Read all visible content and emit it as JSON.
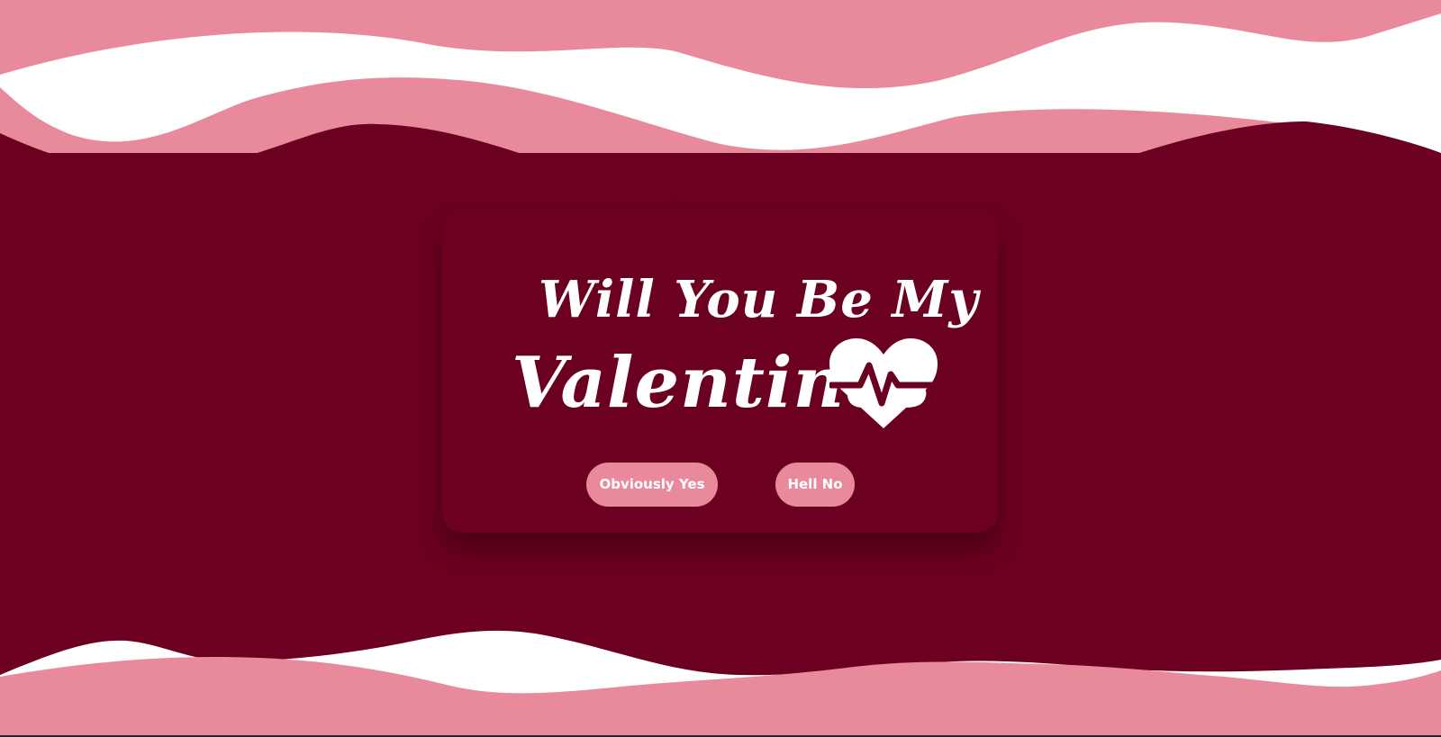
{
  "colors": {
    "background": "#6b0020",
    "wave_pink": "#e88a9c",
    "wave_white": "#ffffff",
    "text": "#ffffff",
    "button_bg": "#e88a9c"
  },
  "hero": {
    "line1": "Will You Be My",
    "line2": "Valentines",
    "icon": "heart-pulse-icon"
  },
  "buttons": {
    "yes_label": "Obviously Yes",
    "no_label": "Hell No"
  }
}
